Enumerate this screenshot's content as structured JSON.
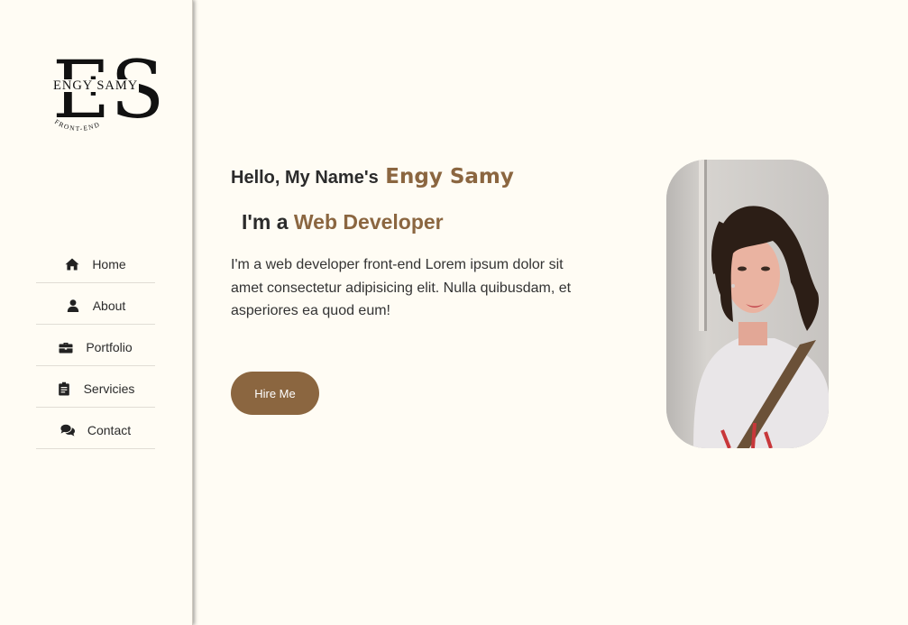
{
  "logo": {
    "monogram": "ES",
    "name": "ENGY SAMY",
    "subtitle": "FRONT-END"
  },
  "nav": {
    "items": [
      {
        "label": "Home",
        "icon": "home-icon"
      },
      {
        "label": "About",
        "icon": "user-icon"
      },
      {
        "label": "Portfolio",
        "icon": "briefcase-icon"
      },
      {
        "label": "Servicies",
        "icon": "clipboard-icon"
      },
      {
        "label": "Contact",
        "icon": "comments-icon"
      }
    ]
  },
  "hero": {
    "greeting": "Hello, My Name's",
    "name": "Engy Samy",
    "role_prefix": "I'm a",
    "role": "Web Developer",
    "description": "I'm a web developer front-end Lorem ipsum dolor sit amet consectetur adipisicing elit. Nulla quibusdam, et asperiores ea quod eum!",
    "cta_label": "Hire Me"
  },
  "colors": {
    "background": "#fffcf4",
    "accent": "#8b6640",
    "text": "#2b2b2b"
  }
}
